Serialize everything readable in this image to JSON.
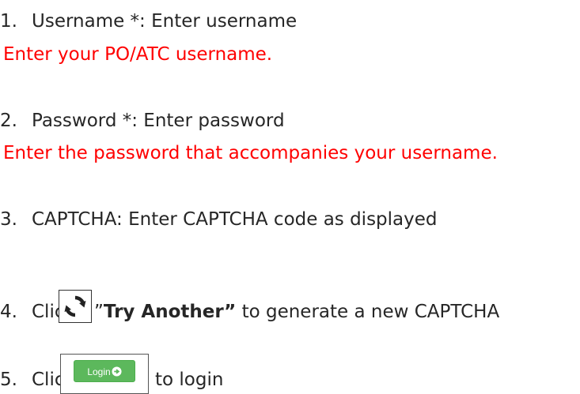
{
  "items": [
    {
      "number": "1.",
      "text": "Username *: Enter username",
      "note": "Enter your PO/ATC username."
    },
    {
      "number": "2.",
      "text": "Password *: Enter password",
      "note": "Enter the password that accompanies your username."
    },
    {
      "number": "3.",
      "text": "CAPTCHA: Enter CAPTCHA code as displayed"
    },
    {
      "number": "4.",
      "prefix": "Click",
      "quote_open": "”",
      "bold": "Try Another”",
      "suffix": "to generate a new CAPTCHA"
    },
    {
      "number": "5.",
      "prefix": "Click",
      "button_label": "Login",
      "suffix": "to login"
    }
  ],
  "icons": {
    "refresh": "refresh-icon",
    "login_arrow": "arrow-circle-right-icon"
  },
  "colors": {
    "note": "#ff0000",
    "login_button": "#5cb85c",
    "text": "#262626"
  }
}
